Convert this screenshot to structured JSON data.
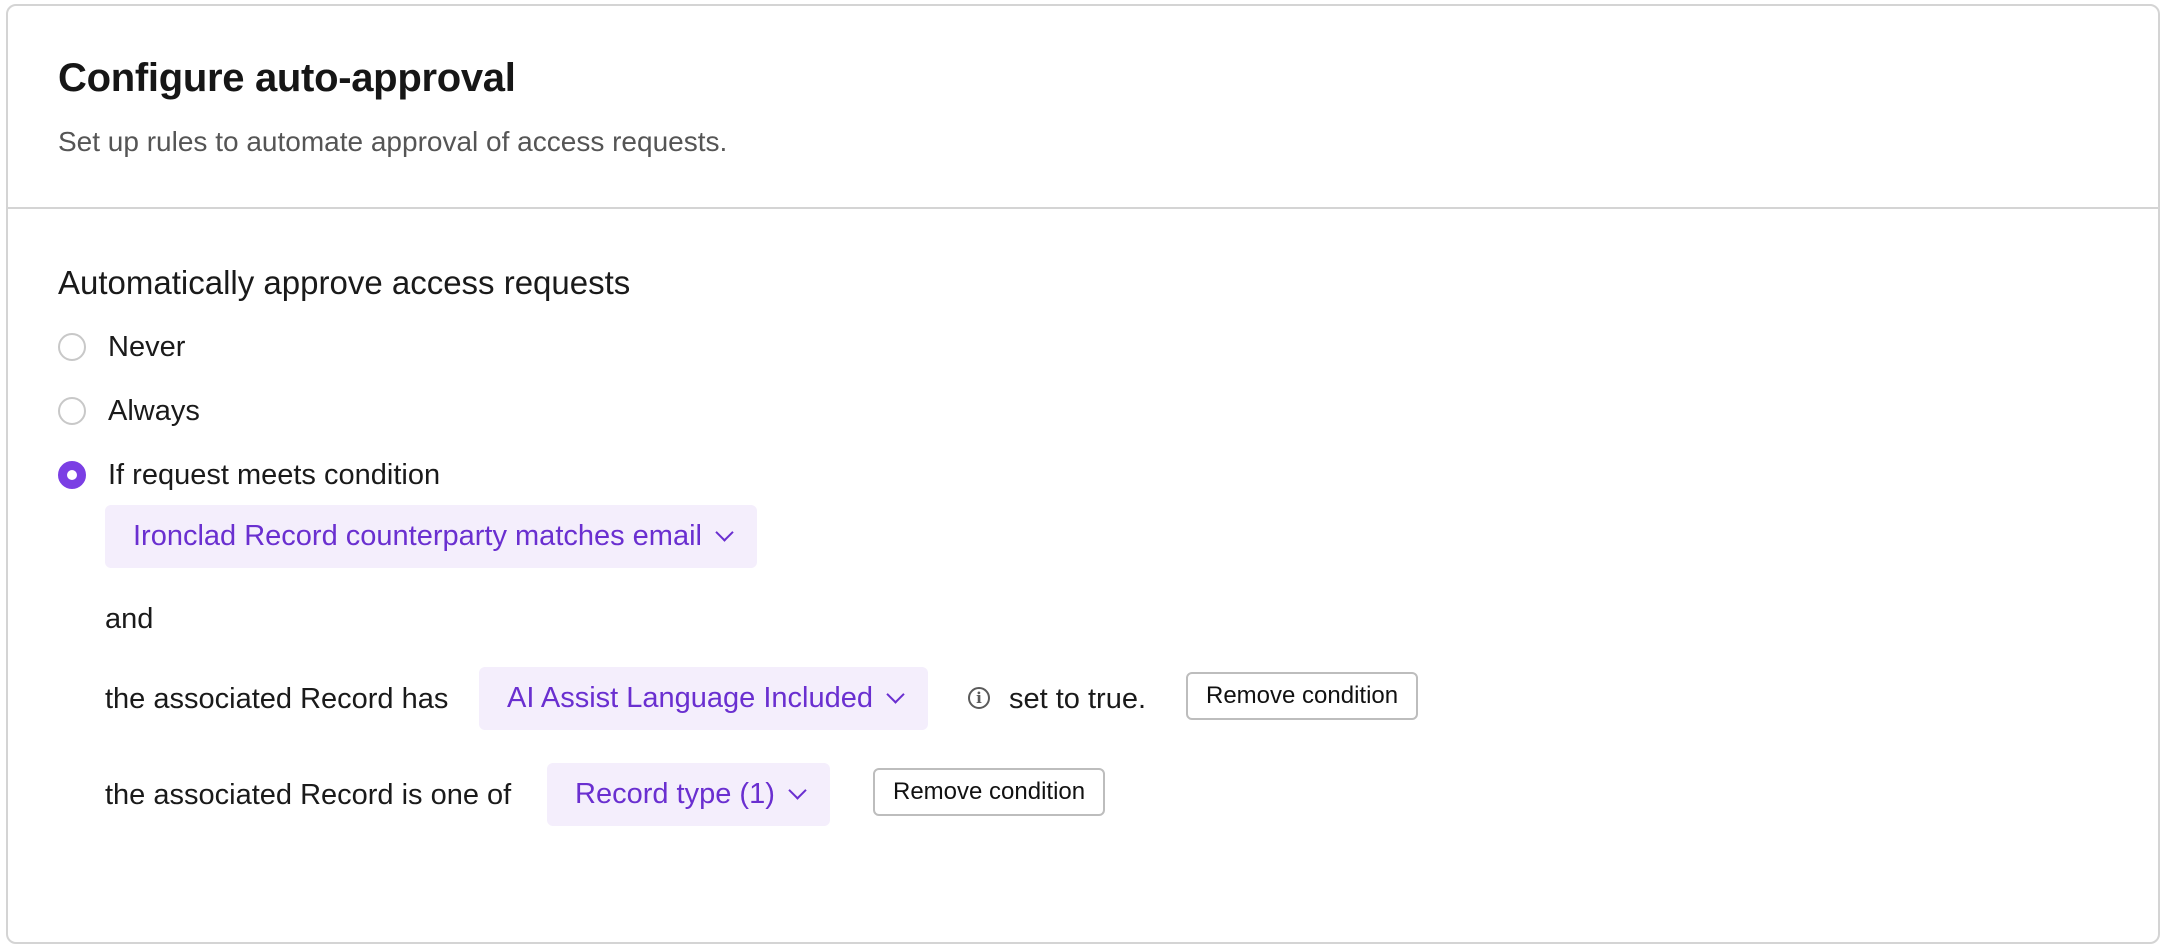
{
  "header": {
    "title": "Configure auto-approval",
    "subtitle": "Set up rules to automate approval of access requests."
  },
  "approval": {
    "label": "Automatically approve access requests",
    "options": [
      {
        "label": "Never",
        "checked": false
      },
      {
        "label": "Always",
        "checked": false
      },
      {
        "label": "If request meets condition",
        "checked": true
      }
    ],
    "selected": "If request meets condition"
  },
  "conditions": {
    "primary_dropdown": "Ironclad Record counterparty matches email",
    "conjunction": "and",
    "rules": [
      {
        "prefix": "the associated Record has",
        "dropdown": "AI Assist Language Included",
        "suffix": "set to true.",
        "has_info_icon": true,
        "remove_label": "Remove condition"
      },
      {
        "prefix": "the associated Record is one of",
        "dropdown": "Record type (1)",
        "remove_label": "Remove condition"
      }
    ]
  },
  "colors": {
    "accent": "#7b3fe4",
    "dropdown_bg": "#f4eefc",
    "dropdown_text": "#6a2fd0",
    "border": "#d4d4d4"
  }
}
